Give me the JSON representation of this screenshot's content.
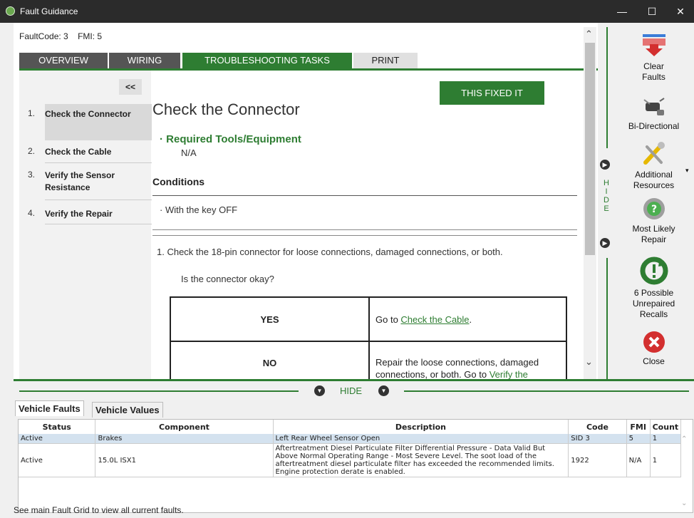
{
  "window": {
    "title": "Fault Guidance"
  },
  "fault": {
    "code_label": "FaultCode: 3",
    "fmi_label": "FMI: 5"
  },
  "tabs": [
    {
      "label": "OVERVIEW"
    },
    {
      "label": "WIRING"
    },
    {
      "label": "TROUBLESHOOTING TASKS"
    },
    {
      "label": "PRINT"
    }
  ],
  "nav": {
    "collapse_label": "<<",
    "items": [
      {
        "num": "1.",
        "label": "Check the Connector"
      },
      {
        "num": "2.",
        "label": "Check the Cable"
      },
      {
        "num": "3.",
        "label": "Verify the Sensor Resistance"
      },
      {
        "num": "4.",
        "label": "Verify the Repair"
      }
    ]
  },
  "content": {
    "fixed_button": "THIS FIXED IT",
    "title": "Check the Connector",
    "required_tools": "· Required Tools/Equipment",
    "required_tools_value": "N/A",
    "conditions_heading": "Conditions",
    "condition_1": "· With the key OFF",
    "step_1": "1.  Check the 18-pin connector for loose connections, damaged connections, or both.",
    "question": "Is the connector okay?",
    "table": {
      "yes_label": "YES",
      "yes_prefix": "Go to ",
      "yes_link": "Check the Cable",
      "yes_suffix": ".",
      "no_label": "NO",
      "no_text": "Repair the loose connections, damaged connections, or both. Go to ",
      "no_link": "Verify the"
    }
  },
  "side_hide": {
    "letters": [
      "H",
      "I",
      "D",
      "E"
    ]
  },
  "right_panel": {
    "clear_faults": "Clear Faults",
    "bidirectional": "Bi-Directional",
    "additional_resources": "Additional Resources",
    "most_likely_repair": "Most Likely Repair",
    "recalls": "6 Possible Unrepaired Recalls",
    "close": "Close"
  },
  "bottom": {
    "hide_label": "HIDE",
    "tab_faults": "Vehicle Faults",
    "tab_values": "Vehicle Values",
    "columns": [
      "Status",
      "Component",
      "Description",
      "Code",
      "FMI",
      "Count"
    ],
    "rows": [
      {
        "status": "Active",
        "component": "Brakes",
        "description": "Left Rear Wheel Sensor Open",
        "code": "SID 3",
        "fmi": "5",
        "count": "1"
      },
      {
        "status": "Active",
        "component": "15.0L ISX1",
        "description": "Aftertreatment Diesel Particulate Filter Differential Pressure - Data Valid But Above Normal Operating Range - Most Severe Level. The soot load of the aftertreatment diesel particulate filter has exceeded the recommended limits. Engine protection derate is enabled.",
        "code": "1922",
        "fmi": "N/A",
        "count": "1"
      }
    ],
    "footer": "See main Fault Grid to view all current faults."
  },
  "colors": {
    "accent_green": "#2e7d32",
    "titlebar": "#2b2b2b",
    "close_red": "#d32f2f",
    "selected_row": "#d4e2ef"
  }
}
